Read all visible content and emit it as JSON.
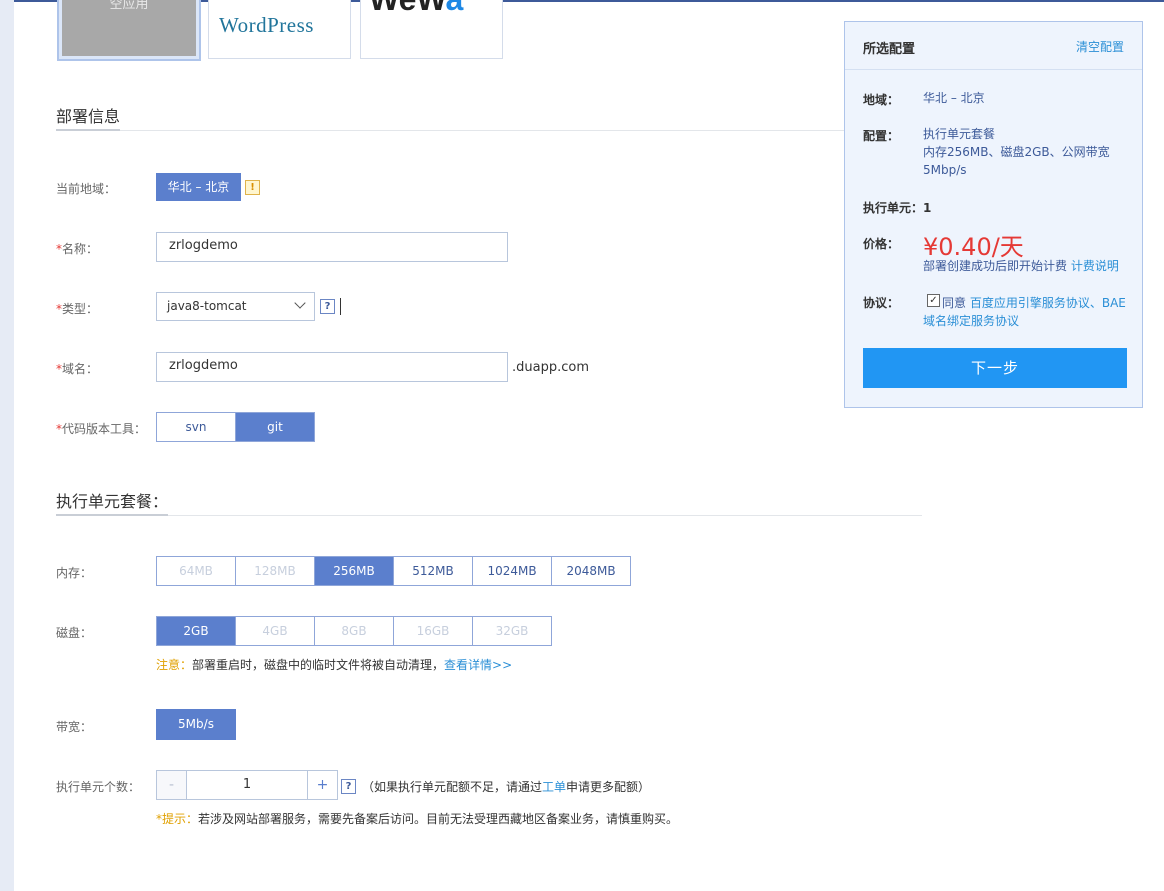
{
  "templates": {
    "selected_label": "空应用",
    "wordpress_label": "WordPress",
    "webapp_label_a": "WeW",
    "webapp_label_b": "a"
  },
  "deploy": {
    "section_title": "部署信息",
    "region_label": "当前地域：",
    "region_value": "华北 – 北京",
    "warn_glyph": "!",
    "name_label": "名称：",
    "name_value": "zrlogdemo",
    "type_label": "类型：",
    "type_value": "java8-tomcat",
    "domain_label": "域名：",
    "domain_value": "zrlogdemo",
    "domain_suffix": ".duapp.com",
    "vcs_label": "代码版本工具：",
    "vcs_options": [
      "svn",
      "git"
    ],
    "vcs_selected": "git",
    "required_mark": "*",
    "help_glyph": "?"
  },
  "package": {
    "section_title": "执行单元套餐：",
    "memory_label": "内存：",
    "memory_options": [
      "64MB",
      "128MB",
      "256MB",
      "512MB",
      "1024MB",
      "2048MB"
    ],
    "memory_selected": "256MB",
    "disk_label": "磁盘：",
    "disk_options": [
      "2GB",
      "4GB",
      "8GB",
      "16GB",
      "32GB"
    ],
    "disk_selected": "2GB",
    "disk_note_prefix": "注意：",
    "disk_note_text": "部署重启时，磁盘中的临时文件将被自动清理，",
    "disk_note_link": "查看详情>>",
    "bandwidth_label": "带宽：",
    "bandwidth_value": "5Mb/s",
    "units_label": "执行单元个数：",
    "units_minus": "-",
    "units_value": "1",
    "units_plus": "+",
    "units_hint_a": "（如果执行单元配额不足，请通过",
    "units_hint_link": "工单",
    "units_hint_b": "申请更多配额）",
    "tip_prefix": "*提示：",
    "tip_text": "若涉及网站部署服务，需要先备案后访问。目前无法受理西藏地区备案业务，请慎重购买。"
  },
  "summary": {
    "title": "所选配置",
    "clear_link": "清空配置",
    "region_key": "地域：",
    "region_value": "华北 – 北京",
    "config_key": "配置：",
    "config_line1": "执行单元套餐",
    "config_line2": "内存256MB、磁盘2GB、公网带宽",
    "config_line3": "5Mbp/s",
    "units_text": "执行单元：1",
    "price_key": "价格：",
    "price_value": "¥0.40/天",
    "price_note": "部署创建成功后即开始计费",
    "price_link": "计费说明",
    "agreement_key": "协议：",
    "agree_text": "同意",
    "agree_link1": "百度应用引擎服务协议、BAE",
    "agree_link2": "域名绑定服务协议",
    "next_button": "下一步",
    "check_glyph": "✓"
  },
  "colors": {
    "primary": "#5b7fcd",
    "button_blue": "#2196f3",
    "price_red": "#e53935",
    "link": "#2b8fd6"
  }
}
